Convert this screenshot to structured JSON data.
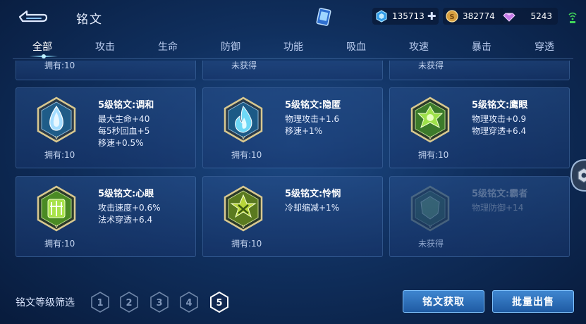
{
  "header": {
    "title": "铭文",
    "diamonds": "135713",
    "coins": "382774",
    "gems": "5243"
  },
  "tabs": [
    {
      "label": "全部",
      "active": true
    },
    {
      "label": "攻击"
    },
    {
      "label": "生命"
    },
    {
      "label": "防御"
    },
    {
      "label": "功能"
    },
    {
      "label": "吸血"
    },
    {
      "label": "攻速"
    },
    {
      "label": "暴击"
    },
    {
      "label": "穿透"
    }
  ],
  "top_row": [
    {
      "status": "拥有:10"
    },
    {
      "status": "未获得"
    },
    {
      "status": "未获得"
    }
  ],
  "cards": [
    {
      "name": "5级铭文:调和",
      "attrs": [
        "最大生命+40",
        "每5秒回血+5",
        "移速+0.5%"
      ],
      "status": "拥有:10",
      "color": "#7ec8f0",
      "dim": false
    },
    {
      "name": "5级铭文:隐匿",
      "attrs": [
        "物理攻击+1.6",
        "移速+1%"
      ],
      "status": "拥有:10",
      "color": "#5fd2f2",
      "dim": false
    },
    {
      "name": "5级铭文:鹰眼",
      "attrs": [
        "物理攻击+0.9",
        "物理穿透+6.4"
      ],
      "status": "拥有:10",
      "color": "#8fd24a",
      "dim": false
    },
    {
      "name": "5级铭文:心眼",
      "attrs": [
        "攻击速度+0.6%",
        "法术穿透+6.4"
      ],
      "status": "拥有:10",
      "color": "#9ad93a",
      "dim": false
    },
    {
      "name": "5级铭文:怜悯",
      "attrs": [
        "冷却缩减+1%"
      ],
      "status": "拥有:10",
      "color": "#a6d12e",
      "dim": false
    },
    {
      "name": "5级铭文:霸者",
      "attrs": [
        "物理防御+14"
      ],
      "status": "未获得",
      "color": "#6fb07a",
      "dim": true
    }
  ],
  "footer": {
    "filter_label": "铭文等级筛选",
    "levels": [
      "1",
      "2",
      "3",
      "4",
      "5"
    ],
    "active_level": "5",
    "obtain_label": "铭文获取",
    "sell_label": "批量出售"
  }
}
